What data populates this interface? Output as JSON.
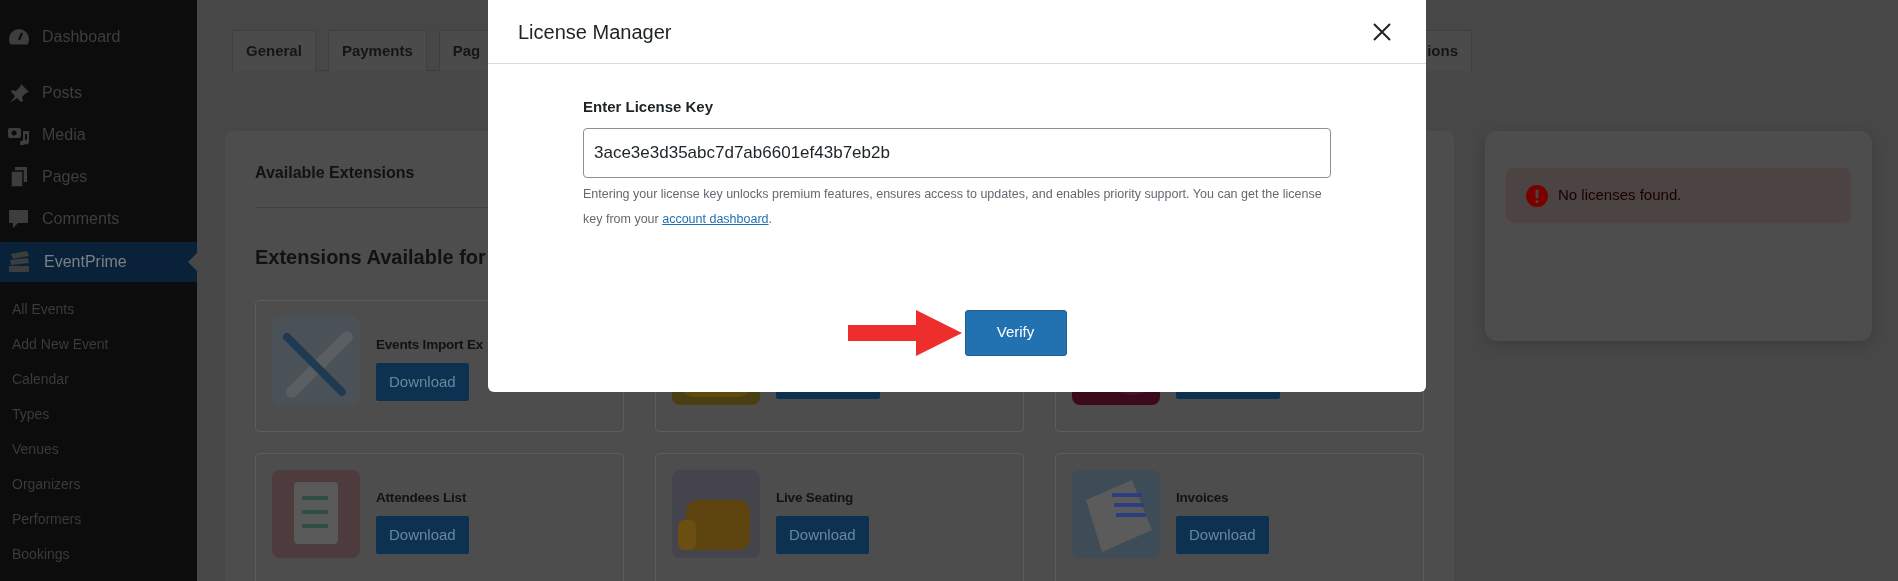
{
  "sidebar": {
    "items": [
      {
        "label": "Dashboard",
        "selected": false
      },
      {
        "label": "Posts",
        "selected": false
      },
      {
        "label": "Media",
        "selected": false
      },
      {
        "label": "Pages",
        "selected": false
      },
      {
        "label": "Comments",
        "selected": false
      },
      {
        "label": "EventPrime",
        "selected": true
      }
    ],
    "submenu": [
      "All Events",
      "Add New Event",
      "Calendar",
      "Types",
      "Venues",
      "Organizers",
      "Performers",
      "Bookings"
    ]
  },
  "tabs": [
    {
      "label": "General"
    },
    {
      "label": "Payments"
    },
    {
      "label": "Pag"
    },
    {
      "label": "ions"
    }
  ],
  "extensions_panel": {
    "title": "Available Extensions",
    "heading": "Extensions Available for",
    "cards": [
      {
        "kind": "full",
        "title": "Events Import Ex",
        "button": "Download"
      },
      {
        "kind": "covered"
      },
      {
        "kind": "covered"
      },
      {
        "kind": "full",
        "title": "Attendees List",
        "button": "Download"
      },
      {
        "kind": "full",
        "title": "Live Seating",
        "button": "Download"
      },
      {
        "kind": "full",
        "title": "Invoices",
        "button": "Download"
      }
    ]
  },
  "license_panel": {
    "message": "No licenses found."
  },
  "modal": {
    "title": "License Manager",
    "field_label": "Enter License Key",
    "field_value": "3ace3e3d35abc7d7ab6601ef43b7eb2b",
    "help_text": "Entering your license key unlocks premium features, ensures access to updates, and enables priority support. You can get the license key from your",
    "help_link": "account dashboard",
    "help_end": ".",
    "button": "Verify"
  }
}
